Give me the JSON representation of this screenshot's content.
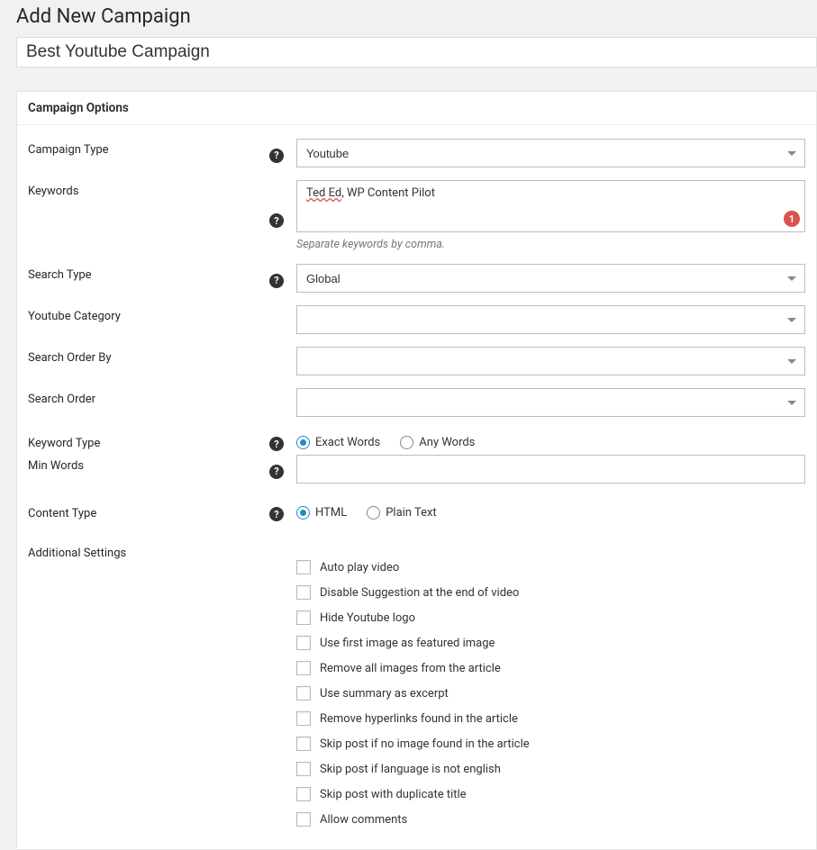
{
  "page": {
    "title": "Add New Campaign"
  },
  "titleInput": {
    "value": "Best Youtube Campaign"
  },
  "panel": {
    "header": "Campaign Options"
  },
  "labels": {
    "campaignType": "Campaign Type",
    "keywords": "Keywords",
    "searchType": "Search Type",
    "youtubeCategory": "Youtube Category",
    "searchOrderBy": "Search Order By",
    "searchOrder": "Search Order",
    "keywordType": "Keyword Type",
    "minWords": "Min Words",
    "contentType": "Content Type",
    "additionalSettings": "Additional Settings"
  },
  "fields": {
    "campaignType": {
      "value": "Youtube"
    },
    "keywords": {
      "spelled": "Ted Ed",
      "rest": ", WP Content Pilot",
      "hint": "Separate keywords by comma.",
      "badge": "1"
    },
    "searchType": {
      "value": "Global"
    },
    "youtubeCategory": {
      "value": ""
    },
    "searchOrderBy": {
      "value": ""
    },
    "searchOrder": {
      "value": ""
    },
    "minWords": {
      "value": ""
    }
  },
  "keywordType": {
    "options": [
      {
        "label": "Exact Words",
        "checked": true
      },
      {
        "label": "Any Words",
        "checked": false
      }
    ]
  },
  "contentType": {
    "options": [
      {
        "label": "HTML",
        "checked": true
      },
      {
        "label": "Plain Text",
        "checked": false
      }
    ]
  },
  "additional": [
    "Auto play video",
    "Disable Suggestion at the end of video",
    "Hide Youtube logo",
    "Use first image as featured image",
    "Remove all images from the article",
    "Use summary as excerpt",
    "Remove hyperlinks found in the article",
    "Skip post if no image found in the article",
    "Skip post if language is not english",
    "Skip post with duplicate title",
    "Allow comments"
  ],
  "glyphs": {
    "help": "?"
  }
}
